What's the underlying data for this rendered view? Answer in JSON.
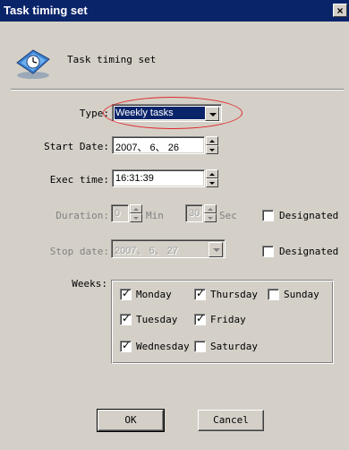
{
  "window": {
    "title": "Task timing set",
    "close_label": "×",
    "header_text": "Task timing set"
  },
  "type": {
    "label": "Type:",
    "value": "Weekly tasks"
  },
  "start_date": {
    "label": "Start Date:",
    "value": "2007、 6、 26"
  },
  "exec_time": {
    "label": "Exec time:",
    "value": "16:31:39"
  },
  "duration": {
    "label": "Duration:",
    "min_value": "0",
    "min_unit": "Min",
    "sec_value": "30",
    "sec_unit": "Sec",
    "designated_label": "Designated",
    "designated_checked": false
  },
  "stop_date": {
    "label": "Stop date:",
    "value": "2007、 6、 27",
    "designated_label": "Designated",
    "designated_checked": false
  },
  "weeks": {
    "label": "Weeks:",
    "days": [
      {
        "name": "Monday",
        "checked": true
      },
      {
        "name": "Thursday",
        "checked": true
      },
      {
        "name": "Sunday",
        "checked": false
      },
      {
        "name": "Tuesday",
        "checked": true
      },
      {
        "name": "Friday",
        "checked": true
      },
      {
        "name": "Wednesday",
        "checked": true
      },
      {
        "name": "Saturday",
        "checked": false
      }
    ]
  },
  "buttons": {
    "ok": "OK",
    "cancel": "Cancel"
  },
  "colors": {
    "titlebar": "#0a246a",
    "highlight_ellipse": "#e0282c",
    "selection": "#0a246a",
    "face": "#d4d0c8"
  }
}
